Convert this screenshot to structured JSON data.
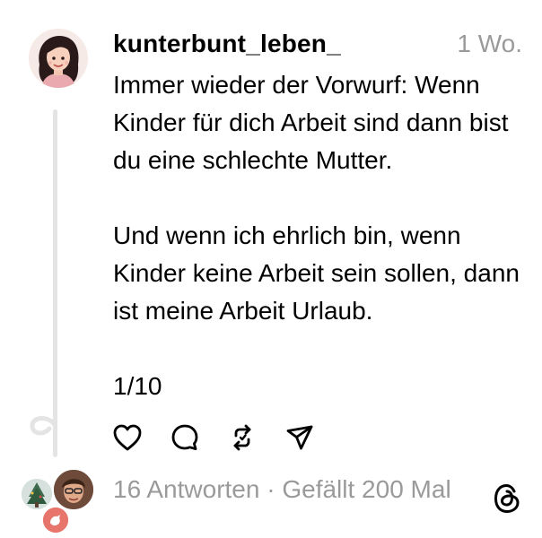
{
  "post": {
    "username": "kunterbunt_leben_",
    "time": "1 Wo.",
    "paragraphs": [
      "Immer wieder der Vorwurf: Wenn Kinder für dich Arbeit sind dann bist du eine schlechte Mutter.",
      "Und wenn ich ehrlich bin, wenn Kinder keine Arbeit sein sollen, dann ist meine Arbeit Urlaub.",
      "1/10"
    ]
  },
  "actions": {
    "icons": [
      "heart-icon",
      "comment-icon",
      "repost-icon",
      "share-icon"
    ]
  },
  "stats": {
    "replies": "16 Antworten",
    "separator": " · ",
    "likes": "Gefällt 200 Mal"
  },
  "colors": {
    "muted_text": "#9a9a9a",
    "thread_line": "#e4e4e4",
    "badge": "#e8756c"
  }
}
